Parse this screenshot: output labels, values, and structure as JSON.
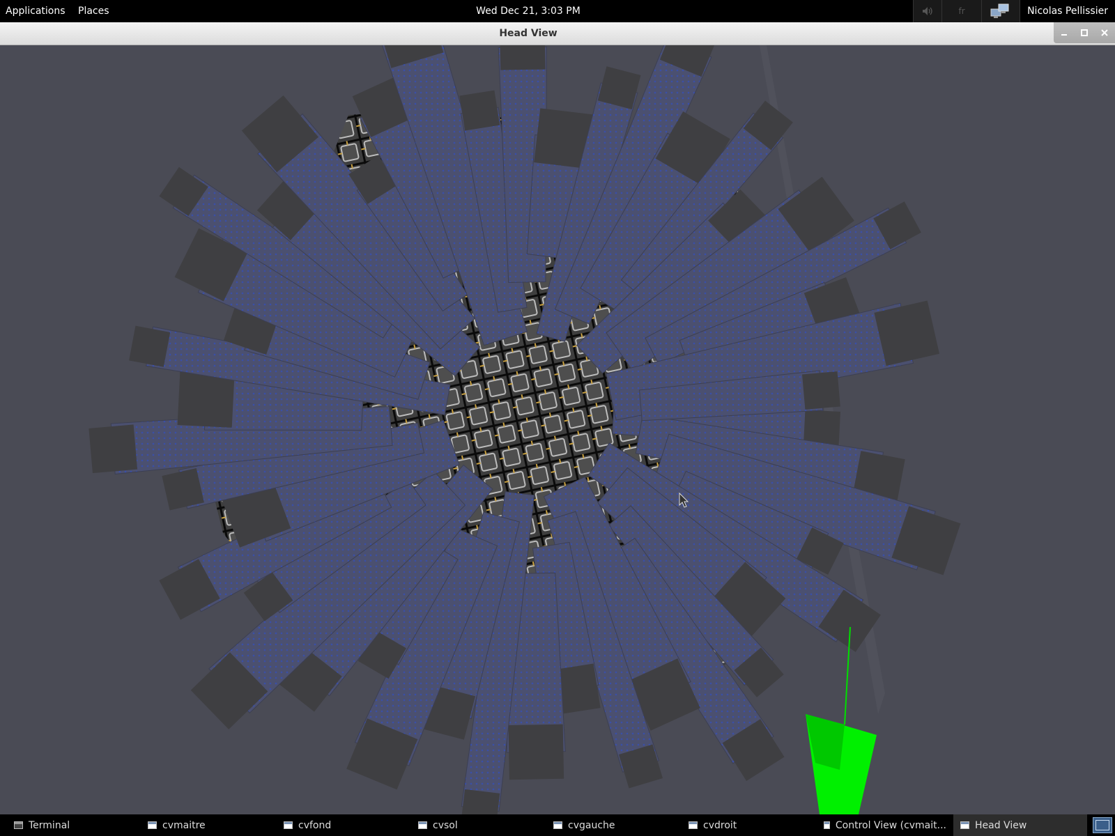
{
  "top_panel": {
    "applications": "Applications",
    "places": "Places",
    "clock": "Wed Dec 21,  3:03 PM",
    "keyboard_layout": "fr",
    "user": "Nicolas Pellissier"
  },
  "window": {
    "title": "Head View"
  },
  "taskbar": {
    "tasks": [
      {
        "label": "Terminal"
      },
      {
        "label": "cvmaitre"
      },
      {
        "label": "cvfond"
      },
      {
        "label": "cvsol"
      },
      {
        "label": "cvgauche"
      },
      {
        "label": "cvdroit"
      },
      {
        "label": "Control View (cvmait..."
      },
      {
        "label": "Head View"
      }
    ],
    "active_task": "Head View"
  },
  "colors": {
    "viewport_background": "#4a4b55",
    "accent_green": "#00ff00",
    "grid_yellow": "#c8a040"
  }
}
